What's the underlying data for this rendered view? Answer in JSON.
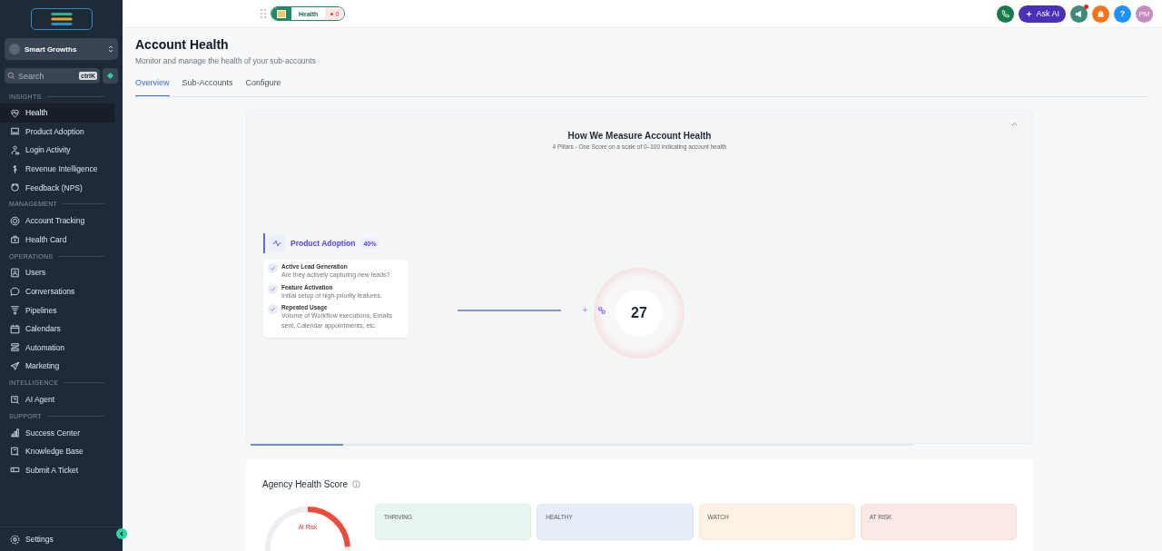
{
  "sidebar": {
    "account": {
      "name": "Smart Growths"
    },
    "search": {
      "placeholder": "Search",
      "shortcut": "ctrlK"
    },
    "sections": [
      {
        "title": "INSIGHTS",
        "items": [
          {
            "label": "Health",
            "selected": true
          },
          {
            "label": "Product Adoption",
            "selected": false
          },
          {
            "label": "Login Activity",
            "selected": false
          },
          {
            "label": "Revenue Intelligence",
            "selected": false
          },
          {
            "label": "Feedback (NPS)",
            "selected": false
          }
        ]
      },
      {
        "title": "MANAGEMENT",
        "items": [
          {
            "label": "Account Tracking",
            "selected": false
          },
          {
            "label": "Health Card",
            "selected": false
          }
        ]
      },
      {
        "title": "OPERATIONS",
        "items": [
          {
            "label": "Users",
            "selected": false
          },
          {
            "label": "Conversations",
            "selected": false
          },
          {
            "label": "Pipelines",
            "selected": false
          },
          {
            "label": "Calendars",
            "selected": false
          },
          {
            "label": "Automation",
            "selected": false
          },
          {
            "label": "Marketing",
            "selected": false
          }
        ]
      },
      {
        "title": "INTELLIGENCE",
        "items": [
          {
            "label": "AI Agent",
            "selected": false
          }
        ]
      },
      {
        "title": "SUPPORT",
        "items": [
          {
            "label": "Success Center",
            "selected": false
          },
          {
            "label": "Knowledge Base",
            "selected": false
          },
          {
            "label": "Submit A Ticket",
            "selected": false
          }
        ]
      }
    ],
    "settings": {
      "label": "Settings"
    }
  },
  "topbar": {
    "pill": {
      "label": "Health",
      "count": "0"
    },
    "ask_ai": "Ask AI",
    "avatar": "PM",
    "help": "?"
  },
  "page": {
    "title": "Account Health",
    "subtitle": "Monitor and manage the health of your sub-accounts",
    "tabs": [
      {
        "label": "Overview",
        "selected": true
      },
      {
        "label": "Sub-Accounts",
        "selected": false
      },
      {
        "label": "Configure",
        "selected": false
      }
    ]
  },
  "measure": {
    "title": "How We Measure Account Health",
    "subtitle": "4 Pillars - One Score on a scale of 0–100 indicating account health",
    "pillar": {
      "name": "Product Adoption",
      "weight": "40%",
      "criteria": [
        {
          "title": "Active Lead Generation",
          "desc": "Are they actively capturing new leads?"
        },
        {
          "title": "Feature Activation",
          "desc": "Initial setup of high-priority features."
        },
        {
          "title": "Repeated Usage",
          "desc": "Volume of Workflow executions, Emails sent, Calendar appointments, etc."
        }
      ]
    },
    "score": "27",
    "progress": {
      "level": 0.14
    }
  },
  "agency": {
    "title": "Agency Health Score",
    "gauge": {
      "label": "At Risk",
      "level": 0.24
    },
    "tiers": [
      {
        "label": "THRIVING",
        "color": "#e8f6ef"
      },
      {
        "label": "HEALTHY",
        "color": "#e6eef9"
      },
      {
        "label": "WATCH",
        "color": "#fdf2e4"
      },
      {
        "label": "AT RISK",
        "color": "#fbe9e7"
      }
    ]
  }
}
